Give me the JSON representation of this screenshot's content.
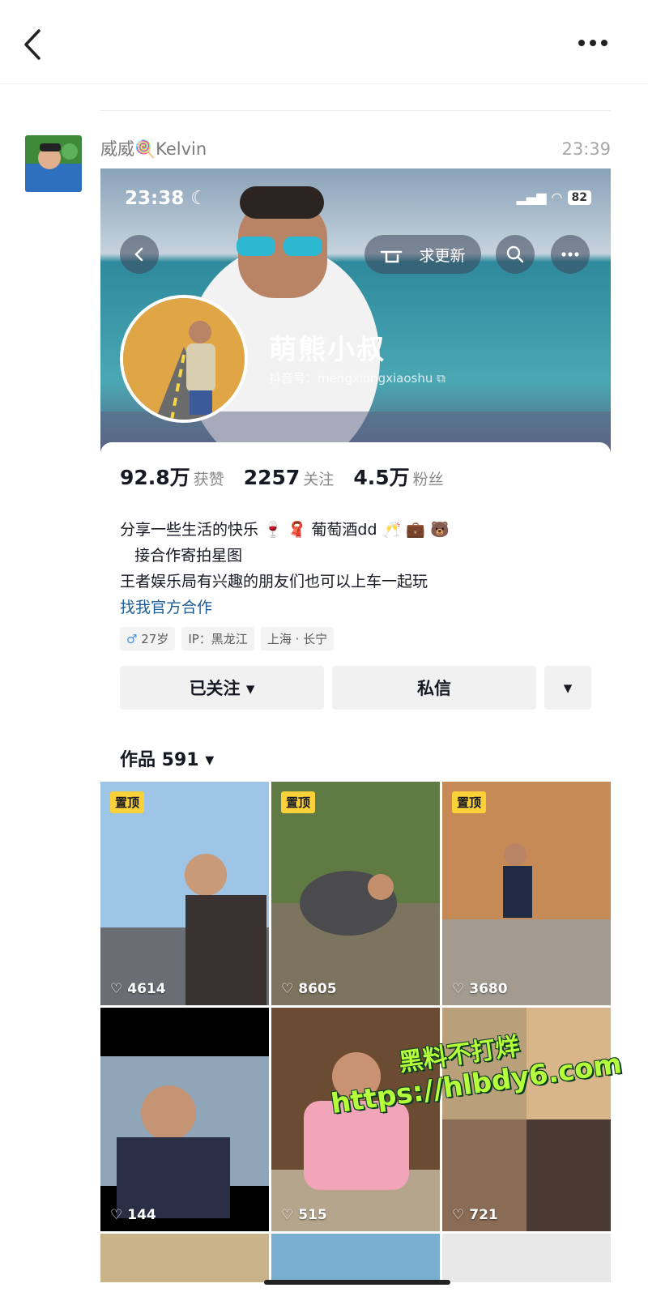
{
  "nav": {
    "back_icon": "chevron-left-icon",
    "more_icon": "more-dots-icon"
  },
  "message": {
    "sender_name": "威威🍭Kelvin",
    "time": "23:39"
  },
  "profile": {
    "status_time": "23:38",
    "battery": "82",
    "update_button": "求更新",
    "nickname": "萌熊小叔",
    "douyin_id": "抖音号：mengxiongxiaoshu",
    "stats": [
      {
        "value": "92.8万",
        "label": "获赞"
      },
      {
        "value": "2257",
        "label": "关注"
      },
      {
        "value": "4.5万",
        "label": "粉丝"
      }
    ],
    "bio_lines": [
      "分享一些生活的快乐 🍷 🧣 葡萄酒dd 🥂 💼 🐻",
      "   接合作寄拍星图",
      "王者娱乐局有兴趣的朋友们也可以上车一起玩"
    ],
    "bio_link": "找我官方合作",
    "tags": {
      "age": "27岁",
      "ip": "IP：黑龙江",
      "location": "上海 · 长宁"
    },
    "actions": {
      "follow": "已关注 ▾",
      "message": "私信",
      "more": "▾"
    },
    "works_label": "作品 591 ▾"
  },
  "videos": [
    {
      "pinned": "置顶",
      "likes": "4614"
    },
    {
      "pinned": "置顶",
      "likes": "8605"
    },
    {
      "pinned": "置顶",
      "likes": "3680"
    },
    {
      "pinned": "",
      "likes": "144"
    },
    {
      "pinned": "",
      "likes": "515"
    },
    {
      "pinned": "",
      "likes": "721"
    }
  ],
  "watermark": {
    "line1": "黑料不打烊",
    "line2": "https://hlbdy6.com"
  },
  "colors": {
    "pin_badge": "#fbd13a",
    "link": "#1e5c96",
    "watermark": "#b6ff3b"
  }
}
